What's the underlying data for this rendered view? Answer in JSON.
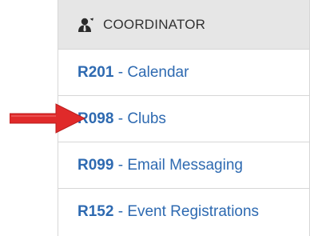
{
  "header": {
    "icon": "user-tie-icon",
    "title": "COORDINATOR"
  },
  "items": [
    {
      "code": "R201",
      "separator": " - ",
      "label": "Calendar"
    },
    {
      "code": "R098",
      "separator": " - ",
      "label": "Clubs"
    },
    {
      "code": "R099",
      "separator": " - ",
      "label": "Email Messaging"
    },
    {
      "code": "R152",
      "separator": " - ",
      "label": "Event Registrations"
    }
  ],
  "annotation": {
    "icon": "red-arrow-icon",
    "color": "#e02a2a"
  },
  "colors": {
    "link": "#2e6ab1",
    "header_bg": "#e6e6e6",
    "border": "#d6d6d6"
  }
}
